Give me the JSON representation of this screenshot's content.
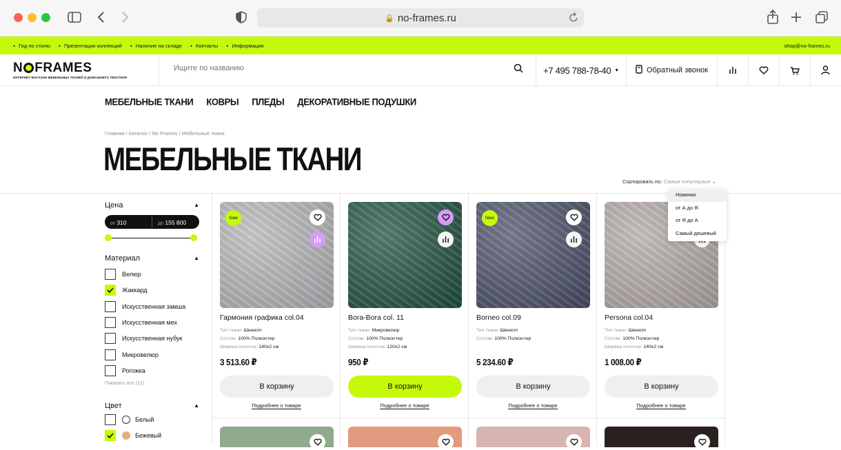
{
  "browser": {
    "url": "no-frames.ru"
  },
  "topbar": {
    "links": [
      "Гид по стилю",
      "Презентации коллекций",
      "Наличие на складе",
      "Контакты",
      "Информация"
    ],
    "email": "shop@no-frames.ru"
  },
  "header": {
    "logo_text_pre": "N",
    "logo_text_post": "FRAMES",
    "logo_tagline": "ИНТЕРНЕТ-МАГАЗИН МЕБЕЛЬНЫХ ТКАНЕЙ И ДОМАШНЕГО ТЕКСТИЛЯ",
    "search_placeholder": "Ищите по названию",
    "phone": "+7 495 788-78-40",
    "callback": "Обратный звонок",
    "icons": [
      "compare-icon",
      "heart-icon",
      "cart-icon",
      "user-icon"
    ]
  },
  "catnav": [
    "МЕБЕЛЬНЫЕ ТКАНИ",
    "КОВРЫ",
    "ПЛЕДЫ",
    "ДЕКОРАТИВНЫЕ ПОДУШКИ"
  ],
  "breadcrumb": "Главная  /  Каталог  /  No Frames  /  Мебельные ткани",
  "page_title": "МЕБЕЛЬНЫЕ ТКАНИ",
  "sort": {
    "label": "Сортировать по:",
    "value": "Самые популярные",
    "options": [
      "Новинки",
      "от А до Я",
      "от Я до А",
      "Самый дешевый"
    ]
  },
  "filters": {
    "price": {
      "title": "Цена",
      "from_label": "от",
      "from": "310",
      "to_label": "до",
      "to": "155 800"
    },
    "material": {
      "title": "Материал",
      "items": [
        {
          "label": "Велюр",
          "checked": false
        },
        {
          "label": "Жаккард",
          "checked": true
        },
        {
          "label": "Искусственная замша",
          "checked": false
        },
        {
          "label": "Искусственная мех",
          "checked": false
        },
        {
          "label": "Искусственная нубук",
          "checked": false
        },
        {
          "label": "Микровелюр",
          "checked": false
        },
        {
          "label": "Рогожка",
          "checked": false
        }
      ],
      "show_all": "Показать все (12)"
    },
    "color": {
      "title": "Цвет",
      "items": [
        {
          "label": "Белый",
          "checked": false,
          "swatch": "#ffffff"
        },
        {
          "label": "Бежевый",
          "checked": true,
          "swatch": "#e0b080"
        }
      ]
    }
  },
  "products": [
    {
      "name": "Гармония графика col.04",
      "badge": "Sale",
      "specs": [
        [
          "Тип ткани:",
          "Шенилл"
        ],
        [
          "Состав:",
          "100% Полиэстер"
        ],
        [
          "Ширина полотна:",
          "140±2 см"
        ]
      ],
      "price": "3 513.60 ₽",
      "cart": "В корзину",
      "more": "Подробнее о товаре",
      "fav_active": false,
      "cmp_active": true,
      "btn_lime": false,
      "color": "#b8b8bc"
    },
    {
      "name": "Bora-Bora col. 11",
      "badge": "",
      "specs": [
        [
          "Тип ткани:",
          "Микровелюр"
        ],
        [
          "Состав:",
          "100% Полиэстер"
        ],
        [
          "Ширина полотна:",
          "120±2 см"
        ]
      ],
      "price": "950 ₽",
      "cart": "В корзину",
      "more": "Подробнее о товаре",
      "fav_active": true,
      "cmp_active": false,
      "btn_lime": true,
      "color": "#1f5240"
    },
    {
      "name": "Borneo col.09",
      "badge": "New",
      "specs": [
        [
          "Тип ткани:",
          "Шенилл"
        ],
        [
          "Состав:",
          "100% Полиэстер"
        ]
      ],
      "price": "5 234.60 ₽",
      "cart": "В корзину",
      "more": "Подробнее о товаре",
      "fav_active": false,
      "cmp_active": false,
      "btn_lime": false,
      "color": "#4a5068"
    },
    {
      "name": "Persona col.04",
      "badge": "",
      "specs": [
        [
          "Тип ткани:",
          "Шенилл"
        ],
        [
          "Состав:",
          "100% Полиэстер"
        ],
        [
          "Ширина полотна:",
          "140±2 см"
        ]
      ],
      "price": "1 008.00 ₽",
      "cart": "В корзину",
      "more": "Подробнее о товаре",
      "fav_active": false,
      "cmp_active": false,
      "btn_lime": false,
      "color": "#b5aca8"
    }
  ],
  "row2_colors": [
    "#8faa8c",
    "#e39b80",
    "#d8b4b0",
    "#2a2220"
  ],
  "colors": {
    "accent": "#c4fa0a",
    "pink": "#d89cf4"
  }
}
